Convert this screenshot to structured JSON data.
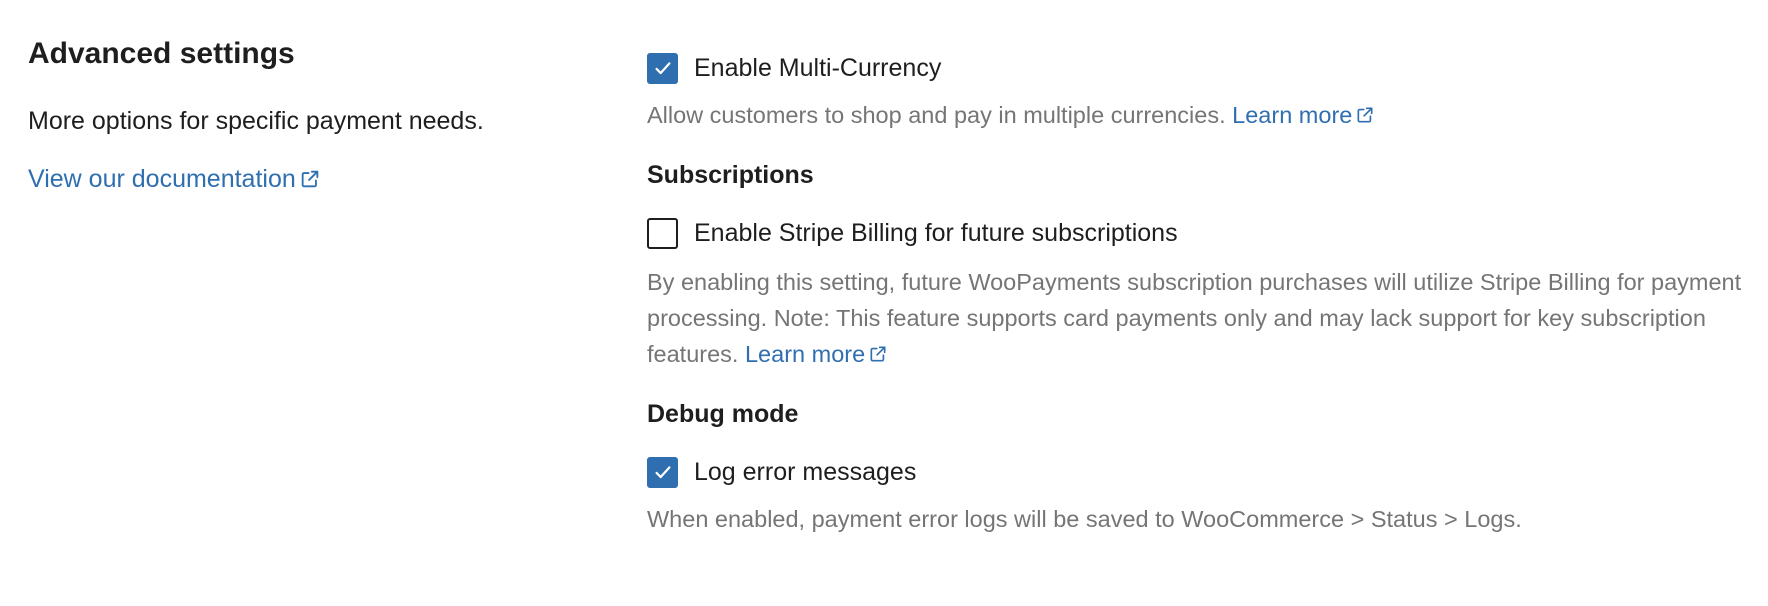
{
  "settings_panel": {
    "title": "Advanced settings",
    "description": "More options for specific payment needs.",
    "documentation_link": "View our documentation"
  },
  "multi_currency": {
    "checked": true,
    "label": "Enable Multi-Currency",
    "help": "Allow customers to shop and pay in multiple currencies.",
    "learn_more": "Learn more"
  },
  "subscriptions": {
    "heading": "Subscriptions",
    "checked": false,
    "label": "Enable Stripe Billing for future subscriptions",
    "help": "By enabling this setting, future WooPayments subscription purchases will utilize Stripe Billing for payment processing. Note: This feature supports card payments only and may lack support for key subscription features.",
    "learn_more": "Learn more"
  },
  "debug_mode": {
    "heading": "Debug mode",
    "checked": true,
    "label": "Log error messages",
    "help": "When enabled, payment error logs will be saved to WooCommerce > Status > Logs."
  },
  "colors": {
    "accent": "#2f6fb0",
    "text": "#1e1e1e",
    "muted": "#757575"
  },
  "icons": {
    "checkmark": "checkmark-icon",
    "external_link": "external-link-icon"
  }
}
